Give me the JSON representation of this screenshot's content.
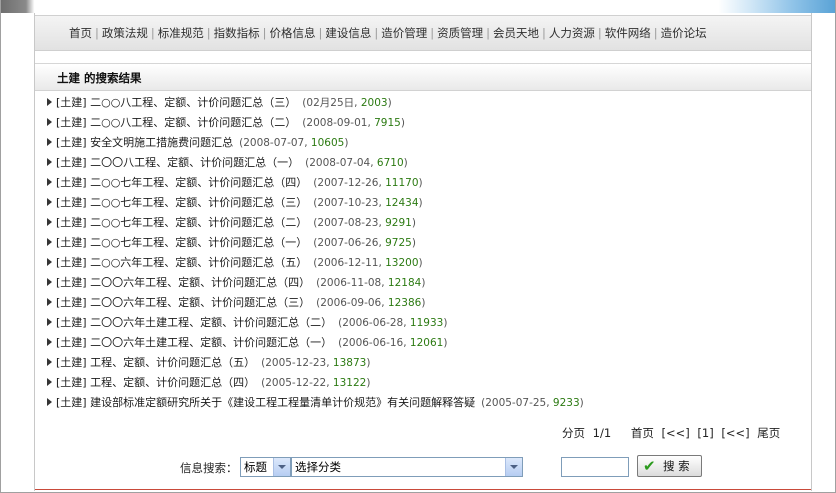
{
  "nav": {
    "items": [
      "首页",
      "政策法规",
      "标准规范",
      "指数指标",
      "价格信息",
      "建设信息",
      "造价管理",
      "资质管理",
      "会员天地",
      "人力资源",
      "软件网络",
      "造价论坛"
    ],
    "separator": "|"
  },
  "results": {
    "title": "土建  的搜索结果",
    "rows": [
      {
        "category": "[土建]",
        "title": "二○○八工程、定额、计价问题汇总（三）",
        "date": "02月25日",
        "hits": "2003"
      },
      {
        "category": "[土建]",
        "title": "二○○八工程、定额、计价问题汇总（二）",
        "date": "2008-09-01",
        "hits": "7915"
      },
      {
        "category": "[土建]",
        "title": "安全文明施工措施费问题汇总",
        "date": "2008-07-07",
        "hits": "10605"
      },
      {
        "category": "[土建]",
        "title": "二〇〇八工程、定额、计价问题汇总（一）",
        "date": "2008-07-04",
        "hits": "6710"
      },
      {
        "category": "[土建]",
        "title": "二○○七年工程、定额、计价问题汇总（四）",
        "date": "2007-12-26",
        "hits": "11170"
      },
      {
        "category": "[土建]",
        "title": "二○○七年工程、定额、计价问题汇总（三）",
        "date": "2007-10-23",
        "hits": "12434"
      },
      {
        "category": "[土建]",
        "title": "二○○七年工程、定额、计价问题汇总（二）",
        "date": "2007-08-23",
        "hits": "9291"
      },
      {
        "category": "[土建]",
        "title": "二○○七年工程、定额、计价问题汇总（一）",
        "date": "2007-06-26",
        "hits": "9725"
      },
      {
        "category": "[土建]",
        "title": "二○○六年工程、定额、计价问题汇总（五）",
        "date": "2006-12-11",
        "hits": "13200"
      },
      {
        "category": "[土建]",
        "title": "二〇〇六年工程、定额、计价问题汇总（四）",
        "date": "2006-11-08",
        "hits": "12184"
      },
      {
        "category": "[土建]",
        "title": "二〇〇六年工程、定额、计价问题汇总（三）",
        "date": "2006-09-06",
        "hits": "12386"
      },
      {
        "category": "[土建]",
        "title": "二〇〇六年土建工程、定额、计价问题汇总（二）",
        "date": "2006-06-28",
        "hits": "11933"
      },
      {
        "category": "[土建]",
        "title": "二〇〇六年土建工程、定额、计价问题汇总（一）",
        "date": "2006-06-16",
        "hits": "12061"
      },
      {
        "category": "[土建]",
        "title": "工程、定额、计价问题汇总（五）",
        "date": "2005-12-23",
        "hits": "13873"
      },
      {
        "category": "[土建]",
        "title": "工程、定额、计价问题汇总（四）",
        "date": "2005-12-22",
        "hits": "13122"
      },
      {
        "category": "[土建]",
        "title": "建设部标准定额研究所关于《建设工程工程量清单计价规范》有关问题解释答疑",
        "date": "2005-07-25",
        "hits": "9233"
      }
    ]
  },
  "pager": {
    "page_label": "分页",
    "page_value": "1/1",
    "first": "首页",
    "prev": "[<<]",
    "current": "[1]",
    "next": "[<<]",
    "last": "尾页"
  },
  "search": {
    "label": "信息搜索：",
    "field_select": "标题",
    "category_select": "选择分类",
    "keyword_value": "",
    "button_label": "搜 索"
  },
  "colors": {
    "hits": "#2c7a12",
    "accent_line": "#c94a3a",
    "button_check": "#2b9a1d"
  },
  "icons": {
    "row_bullet": "triangle-right",
    "button": "checkmark"
  }
}
